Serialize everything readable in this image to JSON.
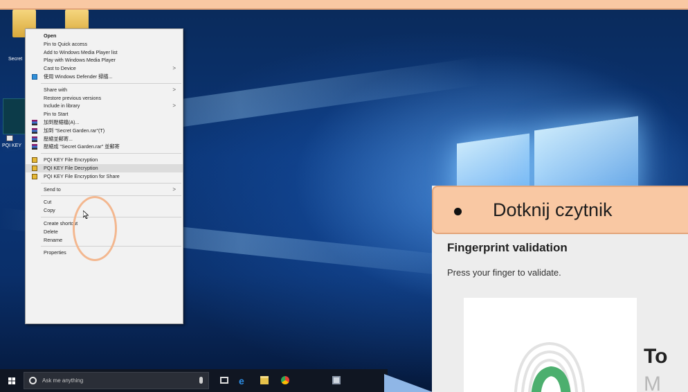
{
  "desktop": {
    "icons": [
      {
        "label": "Secret"
      },
      {
        "label": ""
      },
      {
        "label": "PQI KEY"
      }
    ]
  },
  "context_menu": {
    "items": [
      {
        "label": "Open",
        "bold": true
      },
      {
        "label": "Pin to Quick access"
      },
      {
        "label": "Add to Windows Media Player list"
      },
      {
        "label": "Play with Windows Media Player"
      },
      {
        "label": "Cast to Device",
        "submenu": true
      },
      {
        "label": "使用 Windows Defender 掃描...",
        "icon": "shield-icon"
      },
      {
        "sep": true
      },
      {
        "label": "Share with",
        "submenu": true
      },
      {
        "label": "Restore previous versions"
      },
      {
        "label": "Include in library",
        "submenu": true
      },
      {
        "label": "Pin to Start"
      },
      {
        "label": "加到壓縮檔(A)...",
        "icon": "winrar-icon"
      },
      {
        "label": "加到 \"Secret Garden.rar\"(T)",
        "icon": "winrar-icon"
      },
      {
        "label": "壓縮並郵寄...",
        "icon": "winrar-icon"
      },
      {
        "label": "壓縮成 \"Secret Garden.rar\" 並郵寄",
        "icon": "winrar-icon"
      },
      {
        "sep": true
      },
      {
        "label": "PQI KEY File Encryption",
        "icon": "lock-icon"
      },
      {
        "label": "PQI KEY File Decryption",
        "icon": "lock-icon",
        "highlight": true
      },
      {
        "label": "PQI KEY File Encryption for Share",
        "icon": "lock-icon"
      },
      {
        "sep": true
      },
      {
        "label": "Send to",
        "submenu": true
      },
      {
        "sep": true
      },
      {
        "label": "Cut"
      },
      {
        "label": "Copy"
      },
      {
        "sep": true
      },
      {
        "label": "Create shortcut"
      },
      {
        "label": "Delete"
      },
      {
        "label": "Rename"
      },
      {
        "sep": true
      },
      {
        "label": "Properties"
      }
    ],
    "submenu_arrow": ">"
  },
  "taskbar": {
    "search_placeholder": "Ask me anything"
  },
  "fingerprint": {
    "banner_text": "Dotknij czytnik",
    "title": "Fingerprint validation",
    "subtitle": "Press your finger to validate.",
    "big_text_1": "To",
    "big_text_2": "M"
  },
  "colors": {
    "highlight_banner": "#f9c8a3",
    "focus_circle": "#f3b78f",
    "fingerprint_green": "#4caf6e"
  }
}
